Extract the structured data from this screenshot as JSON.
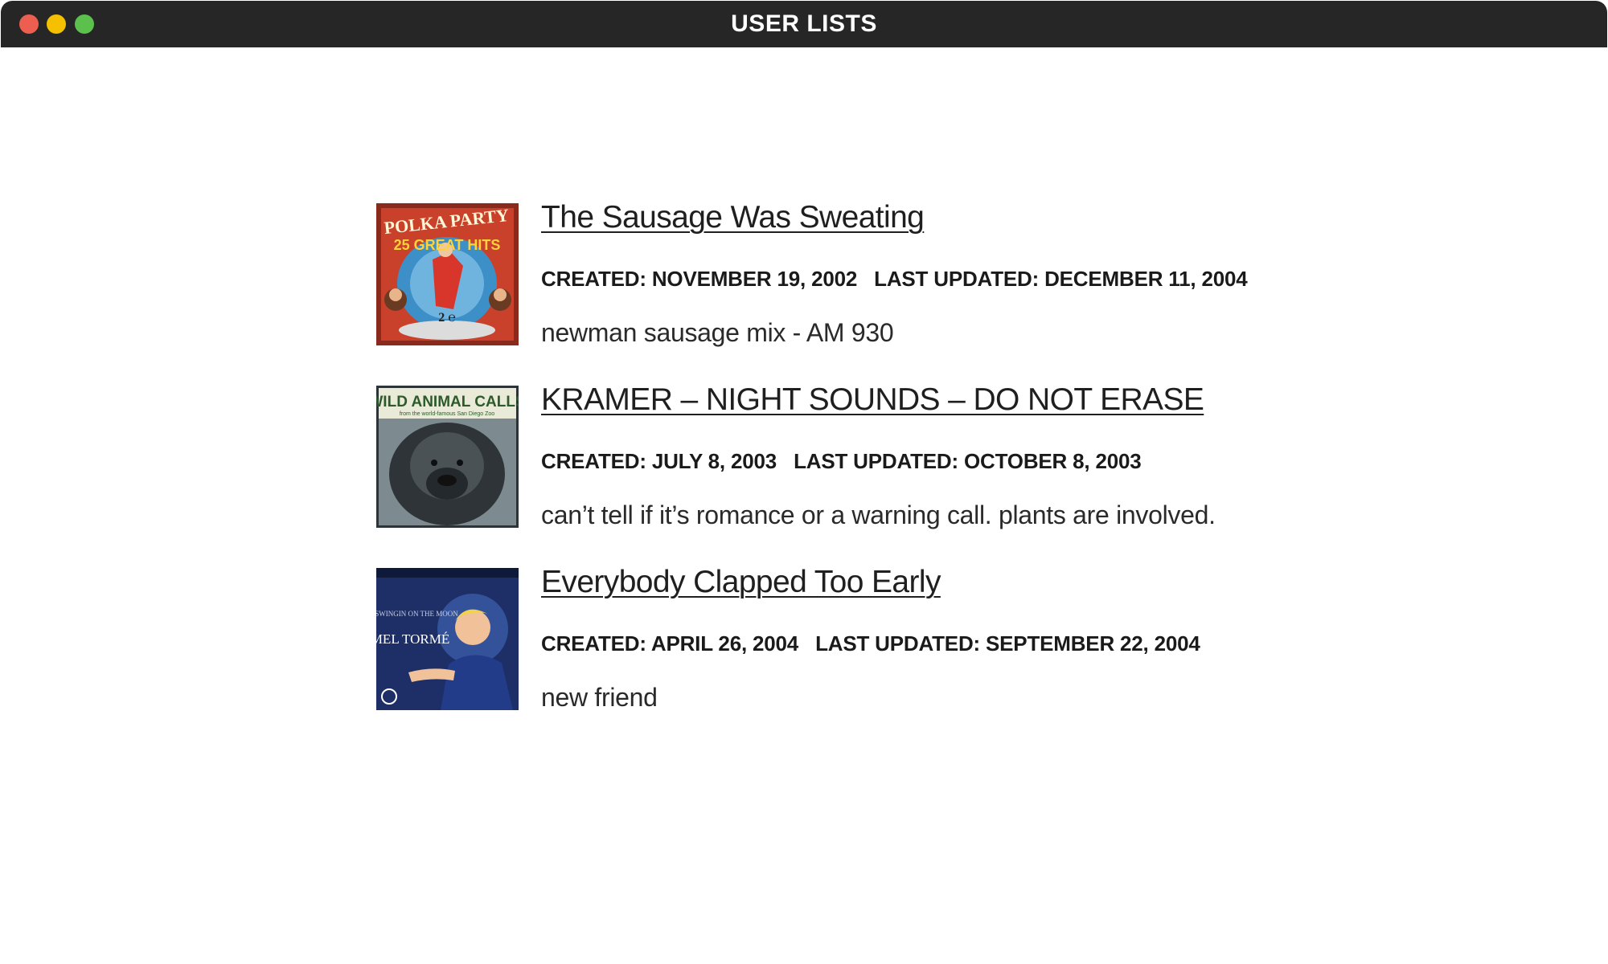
{
  "window": {
    "title": "USER LISTS",
    "controls": {
      "close_color": "#ec5f50",
      "minimize_color": "#f5c000",
      "zoom_color": "#5cc14c"
    }
  },
  "lists": [
    {
      "title": "The Sausage Was Sweating",
      "created_label": "CREATED:",
      "created": "NOVEMBER 19, 2002",
      "updated_label": "LAST UPDATED:",
      "updated": "DECEMBER 11, 2004",
      "description": "newman sausage mix - AM 930",
      "cover": {
        "icon": "album-cover-polka-party",
        "line1": "POLKA PARTY",
        "line2": "25 GREAT HITS"
      }
    },
    {
      "title": "KRAMER – NIGHT SOUNDS – DO NOT ERASE",
      "created_label": "CREATED:",
      "created": "JULY 8, 2003",
      "updated_label": "LAST UPDATED:",
      "updated": "OCTOBER 8, 2003",
      "description": "can’t tell if it’s romance or a warning call. plants are involved.",
      "cover": {
        "icon": "album-cover-wild-animal-calls",
        "line1": "WILD ANIMAL CALLS",
        "line2": "from the world-famous San Diego Zoo"
      }
    },
    {
      "title": "Everybody Clapped Too Early",
      "created_label": "CREATED:",
      "created": "APRIL 26, 2004",
      "updated_label": "LAST UPDATED:",
      "updated": "SEPTEMBER 22, 2004",
      "description": "new friend",
      "cover": {
        "icon": "album-cover-swingin-on-the-moon",
        "line1": "SWINGIN ON THE MOON",
        "line2": "MEL TORMÉ"
      }
    }
  ]
}
